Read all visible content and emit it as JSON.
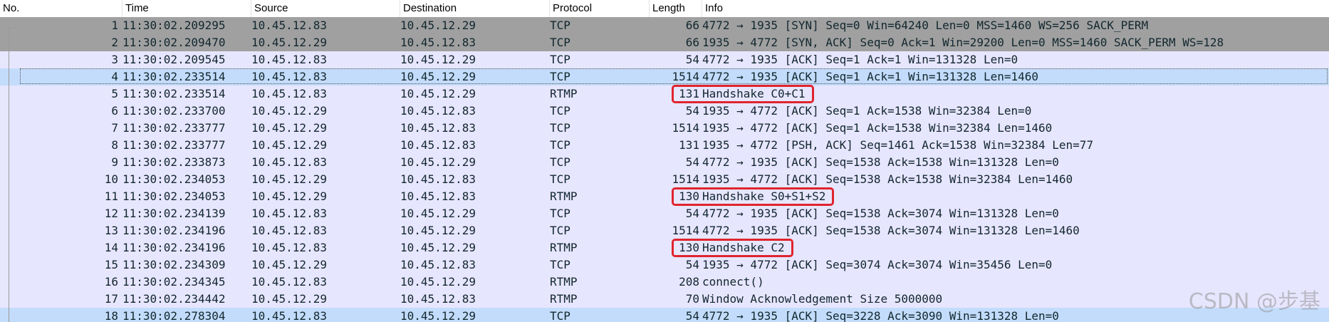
{
  "columns": [
    "No.",
    "Time",
    "Source",
    "Destination",
    "Protocol",
    "Length",
    "Info"
  ],
  "rows": [
    {
      "no": "1",
      "time": "11:30:02.209295",
      "src": "10.45.12.83",
      "dst": "10.45.12.29",
      "proto": "TCP",
      "len": "66",
      "info": "4772 → 1935 [SYN] Seq=0 Win=64240 Len=0 MSS=1460 WS=256 SACK_PERM",
      "style": "syn"
    },
    {
      "no": "2",
      "time": "11:30:02.209470",
      "src": "10.45.12.29",
      "dst": "10.45.12.83",
      "proto": "TCP",
      "len": "66",
      "info": "1935 → 4772 [SYN, ACK] Seq=0 Ack=1 Win=29200 Len=0 MSS=1460 SACK_PERM WS=128",
      "style": "syn"
    },
    {
      "no": "3",
      "time": "11:30:02.209545",
      "src": "10.45.12.83",
      "dst": "10.45.12.29",
      "proto": "TCP",
      "len": "54",
      "info": "4772 → 1935 [ACK] Seq=1 Ack=1 Win=131328 Len=0",
      "style": "normal"
    },
    {
      "no": "4",
      "time": "11:30:02.233514",
      "src": "10.45.12.83",
      "dst": "10.45.12.29",
      "proto": "TCP",
      "len": "1514",
      "info": "4772 → 1935 [ACK] Seq=1 Ack=1 Win=131328 Len=1460",
      "style": "sel"
    },
    {
      "no": "5",
      "time": "11:30:02.233514",
      "src": "10.45.12.83",
      "dst": "10.45.12.29",
      "proto": "RTMP",
      "len": "131",
      "info": "Handshake C0+C1",
      "style": "normal"
    },
    {
      "no": "6",
      "time": "11:30:02.233700",
      "src": "10.45.12.29",
      "dst": "10.45.12.83",
      "proto": "TCP",
      "len": "54",
      "info": "1935 → 4772 [ACK] Seq=1 Ack=1538 Win=32384 Len=0",
      "style": "normal"
    },
    {
      "no": "7",
      "time": "11:30:02.233777",
      "src": "10.45.12.29",
      "dst": "10.45.12.83",
      "proto": "TCP",
      "len": "1514",
      "info": "1935 → 4772 [ACK] Seq=1 Ack=1538 Win=32384 Len=1460",
      "style": "normal"
    },
    {
      "no": "8",
      "time": "11:30:02.233777",
      "src": "10.45.12.29",
      "dst": "10.45.12.83",
      "proto": "TCP",
      "len": "131",
      "info": "1935 → 4772 [PSH, ACK] Seq=1461 Ack=1538 Win=32384 Len=77",
      "style": "normal"
    },
    {
      "no": "9",
      "time": "11:30:02.233873",
      "src": "10.45.12.83",
      "dst": "10.45.12.29",
      "proto": "TCP",
      "len": "54",
      "info": "4772 → 1935 [ACK] Seq=1538 Ack=1538 Win=131328 Len=0",
      "style": "normal"
    },
    {
      "no": "10",
      "time": "11:30:02.234053",
      "src": "10.45.12.29",
      "dst": "10.45.12.83",
      "proto": "TCP",
      "len": "1514",
      "info": "1935 → 4772 [ACK] Seq=1538 Ack=1538 Win=32384 Len=1460",
      "style": "normal"
    },
    {
      "no": "11",
      "time": "11:30:02.234053",
      "src": "10.45.12.29",
      "dst": "10.45.12.83",
      "proto": "RTMP",
      "len": "130",
      "info": "Handshake S0+S1+S2",
      "style": "normal"
    },
    {
      "no": "12",
      "time": "11:30:02.234139",
      "src": "10.45.12.83",
      "dst": "10.45.12.29",
      "proto": "TCP",
      "len": "54",
      "info": "4772 → 1935 [ACK] Seq=1538 Ack=3074 Win=131328 Len=0",
      "style": "normal"
    },
    {
      "no": "13",
      "time": "11:30:02.234196",
      "src": "10.45.12.83",
      "dst": "10.45.12.29",
      "proto": "TCP",
      "len": "1514",
      "info": "4772 → 1935 [ACK] Seq=1538 Ack=3074 Win=131328 Len=1460",
      "style": "normal"
    },
    {
      "no": "14",
      "time": "11:30:02.234196",
      "src": "10.45.12.83",
      "dst": "10.45.12.29",
      "proto": "RTMP",
      "len": "130",
      "info": "Handshake C2",
      "style": "normal"
    },
    {
      "no": "15",
      "time": "11:30:02.234309",
      "src": "10.45.12.29",
      "dst": "10.45.12.83",
      "proto": "TCP",
      "len": "54",
      "info": "1935 → 4772 [ACK] Seq=3074 Ack=3074 Win=35456 Len=0",
      "style": "normal"
    },
    {
      "no": "16",
      "time": "11:30:02.234345",
      "src": "10.45.12.83",
      "dst": "10.45.12.29",
      "proto": "RTMP",
      "len": "208",
      "info": "connect()",
      "style": "normal"
    },
    {
      "no": "17",
      "time": "11:30:02.234442",
      "src": "10.45.12.29",
      "dst": "10.45.12.83",
      "proto": "RTMP",
      "len": "70",
      "info": "Window Acknowledgement Size 5000000",
      "style": "normal"
    },
    {
      "no": "18",
      "time": "11:30:02.278304",
      "src": "10.45.12.83",
      "dst": "10.45.12.29",
      "proto": "TCP",
      "len": "54",
      "info": "4772 → 1935 [ACK] Seq=3228 Ack=3090 Win=131328 Len=0",
      "style": "sel"
    }
  ],
  "highlighted_rows": [
    "5",
    "11",
    "14"
  ],
  "watermark": "CSDN @步基",
  "colors": {
    "row_default": "#e7e6ff",
    "row_syn": "#a0a0a0",
    "row_selected": "#c3dcfb",
    "highlight_box": "#e0242e",
    "text": "#12272e"
  }
}
